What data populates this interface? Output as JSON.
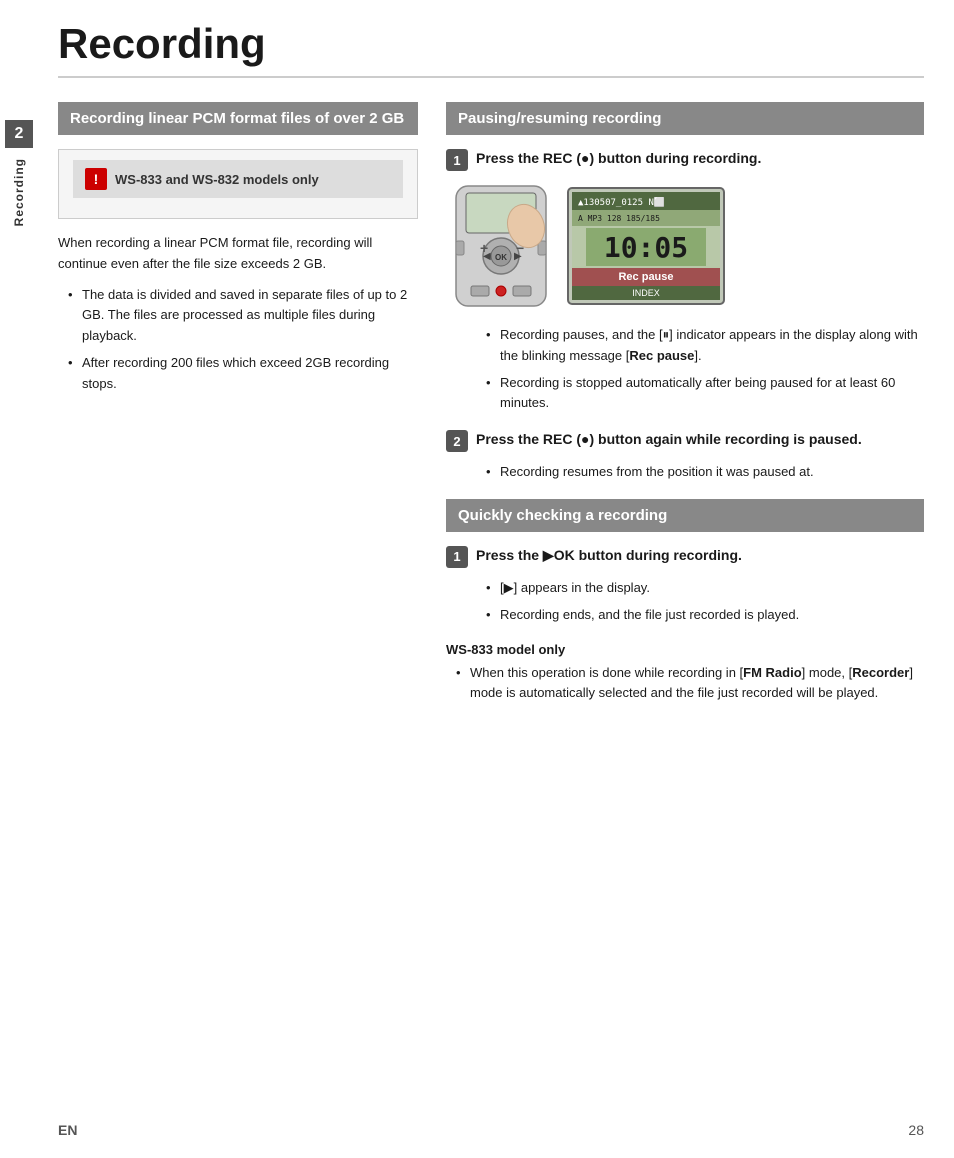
{
  "page": {
    "title": "Recording",
    "footer_lang": "EN",
    "footer_page": "28"
  },
  "sidebar": {
    "number": "2",
    "label": "Recording"
  },
  "left_column": {
    "section_title": "Recording linear PCM format files of over 2 GB",
    "warning_title": "WS-833 and WS-832 models only",
    "warning_icon": "!",
    "body_text": "When recording a linear PCM format file, recording will continue even after the file size exceeds 2 GB.",
    "bullets": [
      "The data is divided and saved in separate files of up to 2 GB. The files are processed as multiple files during playback.",
      "After recording 200 files which exceed 2GB recording stops."
    ]
  },
  "right_column": {
    "section1_title": "Pausing/resuming recording",
    "step1_title": "Press the REC (●) button during recording.",
    "step1_badge": "1",
    "step1_bullets": [
      "Recording pauses, and the [⏸] indicator appears in the display along with the blinking message [Rec pause].",
      "Recording is stopped automatically after being paused for at least 60 minutes."
    ],
    "step2_badge": "2",
    "step2_title": "Press the REC (●) button again while recording is paused.",
    "step2_bullets": [
      "Recording resumes from the position it was paused at."
    ],
    "section2_title": "Quickly checking a recording",
    "step3_badge": "1",
    "step3_title": "Press the ▶OK button during recording.",
    "step3_bullets": [
      "[▶] appears in the display.",
      "Recording ends, and the file just recorded is played."
    ],
    "ws833_title": "WS-833 model only",
    "ws833_bullets": [
      "When this operation is done while recording in [FM Radio] mode, [Recorder] mode is automatically selected and the file just recorded will be played."
    ]
  }
}
